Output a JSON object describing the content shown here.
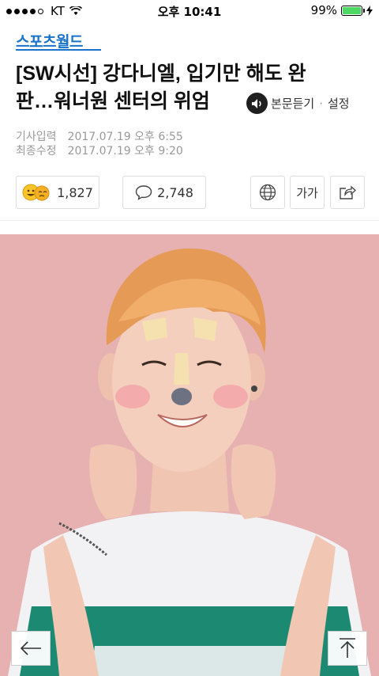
{
  "status_bar": {
    "carrier": "KT",
    "time": "오후 10:41",
    "battery": "99%",
    "battery_level": 0.99
  },
  "brand": {
    "name": "스포츠월드",
    "color": "#1a73c8"
  },
  "article": {
    "title_line1": "[SW시선] 강다니엘, 입기만 해도 완",
    "title_line2": "판…워너원 센터의 위엄",
    "tts_label": "본문듣기",
    "settings_label": "설정",
    "published_label": "기사입력",
    "published_value": "2017.07.19 오후 6:55",
    "modified_label": "최종수정",
    "modified_value": "2017.07.19 오후 9:20"
  },
  "actions": {
    "reactions_count": "1,827",
    "comments_count": "2,748",
    "font_size_label": "가가"
  },
  "icons": {
    "wifi": "wifi-icon",
    "battery": "battery-icon",
    "charging": "charging-icon",
    "tts": "speaker-icon",
    "reactions": "emoji-faces-icon",
    "comments": "comment-bubble-icon",
    "translate": "globe-icon",
    "share": "share-icon",
    "back": "arrow-left-icon",
    "top": "arrow-up-icon"
  }
}
